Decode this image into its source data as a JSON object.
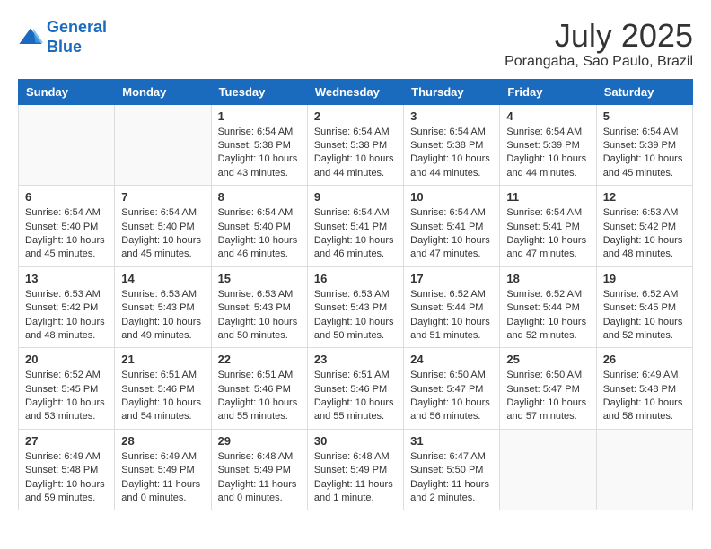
{
  "header": {
    "logo_line1": "General",
    "logo_line2": "Blue",
    "month_title": "July 2025",
    "location": "Porangaba, Sao Paulo, Brazil"
  },
  "weekdays": [
    "Sunday",
    "Monday",
    "Tuesday",
    "Wednesday",
    "Thursday",
    "Friday",
    "Saturday"
  ],
  "weeks": [
    [
      {
        "day": "",
        "info": ""
      },
      {
        "day": "",
        "info": ""
      },
      {
        "day": "1",
        "info": "Sunrise: 6:54 AM\nSunset: 5:38 PM\nDaylight: 10 hours and 43 minutes."
      },
      {
        "day": "2",
        "info": "Sunrise: 6:54 AM\nSunset: 5:38 PM\nDaylight: 10 hours and 44 minutes."
      },
      {
        "day": "3",
        "info": "Sunrise: 6:54 AM\nSunset: 5:38 PM\nDaylight: 10 hours and 44 minutes."
      },
      {
        "day": "4",
        "info": "Sunrise: 6:54 AM\nSunset: 5:39 PM\nDaylight: 10 hours and 44 minutes."
      },
      {
        "day": "5",
        "info": "Sunrise: 6:54 AM\nSunset: 5:39 PM\nDaylight: 10 hours and 45 minutes."
      }
    ],
    [
      {
        "day": "6",
        "info": "Sunrise: 6:54 AM\nSunset: 5:40 PM\nDaylight: 10 hours and 45 minutes."
      },
      {
        "day": "7",
        "info": "Sunrise: 6:54 AM\nSunset: 5:40 PM\nDaylight: 10 hours and 45 minutes."
      },
      {
        "day": "8",
        "info": "Sunrise: 6:54 AM\nSunset: 5:40 PM\nDaylight: 10 hours and 46 minutes."
      },
      {
        "day": "9",
        "info": "Sunrise: 6:54 AM\nSunset: 5:41 PM\nDaylight: 10 hours and 46 minutes."
      },
      {
        "day": "10",
        "info": "Sunrise: 6:54 AM\nSunset: 5:41 PM\nDaylight: 10 hours and 47 minutes."
      },
      {
        "day": "11",
        "info": "Sunrise: 6:54 AM\nSunset: 5:41 PM\nDaylight: 10 hours and 47 minutes."
      },
      {
        "day": "12",
        "info": "Sunrise: 6:53 AM\nSunset: 5:42 PM\nDaylight: 10 hours and 48 minutes."
      }
    ],
    [
      {
        "day": "13",
        "info": "Sunrise: 6:53 AM\nSunset: 5:42 PM\nDaylight: 10 hours and 48 minutes."
      },
      {
        "day": "14",
        "info": "Sunrise: 6:53 AM\nSunset: 5:43 PM\nDaylight: 10 hours and 49 minutes."
      },
      {
        "day": "15",
        "info": "Sunrise: 6:53 AM\nSunset: 5:43 PM\nDaylight: 10 hours and 50 minutes."
      },
      {
        "day": "16",
        "info": "Sunrise: 6:53 AM\nSunset: 5:43 PM\nDaylight: 10 hours and 50 minutes."
      },
      {
        "day": "17",
        "info": "Sunrise: 6:52 AM\nSunset: 5:44 PM\nDaylight: 10 hours and 51 minutes."
      },
      {
        "day": "18",
        "info": "Sunrise: 6:52 AM\nSunset: 5:44 PM\nDaylight: 10 hours and 52 minutes."
      },
      {
        "day": "19",
        "info": "Sunrise: 6:52 AM\nSunset: 5:45 PM\nDaylight: 10 hours and 52 minutes."
      }
    ],
    [
      {
        "day": "20",
        "info": "Sunrise: 6:52 AM\nSunset: 5:45 PM\nDaylight: 10 hours and 53 minutes."
      },
      {
        "day": "21",
        "info": "Sunrise: 6:51 AM\nSunset: 5:46 PM\nDaylight: 10 hours and 54 minutes."
      },
      {
        "day": "22",
        "info": "Sunrise: 6:51 AM\nSunset: 5:46 PM\nDaylight: 10 hours and 55 minutes."
      },
      {
        "day": "23",
        "info": "Sunrise: 6:51 AM\nSunset: 5:46 PM\nDaylight: 10 hours and 55 minutes."
      },
      {
        "day": "24",
        "info": "Sunrise: 6:50 AM\nSunset: 5:47 PM\nDaylight: 10 hours and 56 minutes."
      },
      {
        "day": "25",
        "info": "Sunrise: 6:50 AM\nSunset: 5:47 PM\nDaylight: 10 hours and 57 minutes."
      },
      {
        "day": "26",
        "info": "Sunrise: 6:49 AM\nSunset: 5:48 PM\nDaylight: 10 hours and 58 minutes."
      }
    ],
    [
      {
        "day": "27",
        "info": "Sunrise: 6:49 AM\nSunset: 5:48 PM\nDaylight: 10 hours and 59 minutes."
      },
      {
        "day": "28",
        "info": "Sunrise: 6:49 AM\nSunset: 5:49 PM\nDaylight: 11 hours and 0 minutes."
      },
      {
        "day": "29",
        "info": "Sunrise: 6:48 AM\nSunset: 5:49 PM\nDaylight: 11 hours and 0 minutes."
      },
      {
        "day": "30",
        "info": "Sunrise: 6:48 AM\nSunset: 5:49 PM\nDaylight: 11 hours and 1 minute."
      },
      {
        "day": "31",
        "info": "Sunrise: 6:47 AM\nSunset: 5:50 PM\nDaylight: 11 hours and 2 minutes."
      },
      {
        "day": "",
        "info": ""
      },
      {
        "day": "",
        "info": ""
      }
    ]
  ]
}
